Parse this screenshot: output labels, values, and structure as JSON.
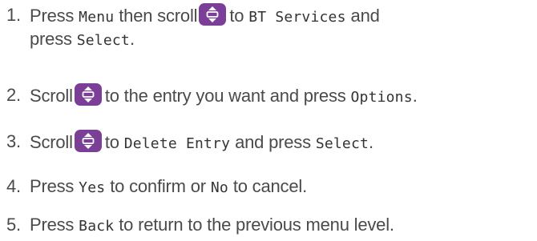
{
  "colors": {
    "text": "#4a4a4a",
    "key_background": "#7b3f98",
    "key_symbol": "#ffffff"
  },
  "icons": {
    "scroll_key": "scroll-up-down-key-icon"
  },
  "steps": [
    {
      "number": "1.",
      "press": "Press",
      "menu": "Menu",
      "then_scroll": "then scroll",
      "to": "to",
      "bt_services": "BT Services",
      "and": "and",
      "press2": "press",
      "select": "Select",
      "period": "."
    },
    {
      "number": "2.",
      "scroll": "Scroll",
      "rest": "to the entry you want and press",
      "options": "Options",
      "period": "."
    },
    {
      "number": "3.",
      "scroll": "Scroll",
      "to": "to",
      "delete_entry": "Delete Entry",
      "and_press": "and press",
      "select": "Select",
      "period": "."
    },
    {
      "number": "4.",
      "press": "Press",
      "yes": "Yes",
      "middle": "to confirm or",
      "no": "No",
      "end": "to cancel."
    },
    {
      "number": "5.",
      "press": "Press",
      "back": "Back",
      "end": "to return to the previous menu level."
    }
  ]
}
